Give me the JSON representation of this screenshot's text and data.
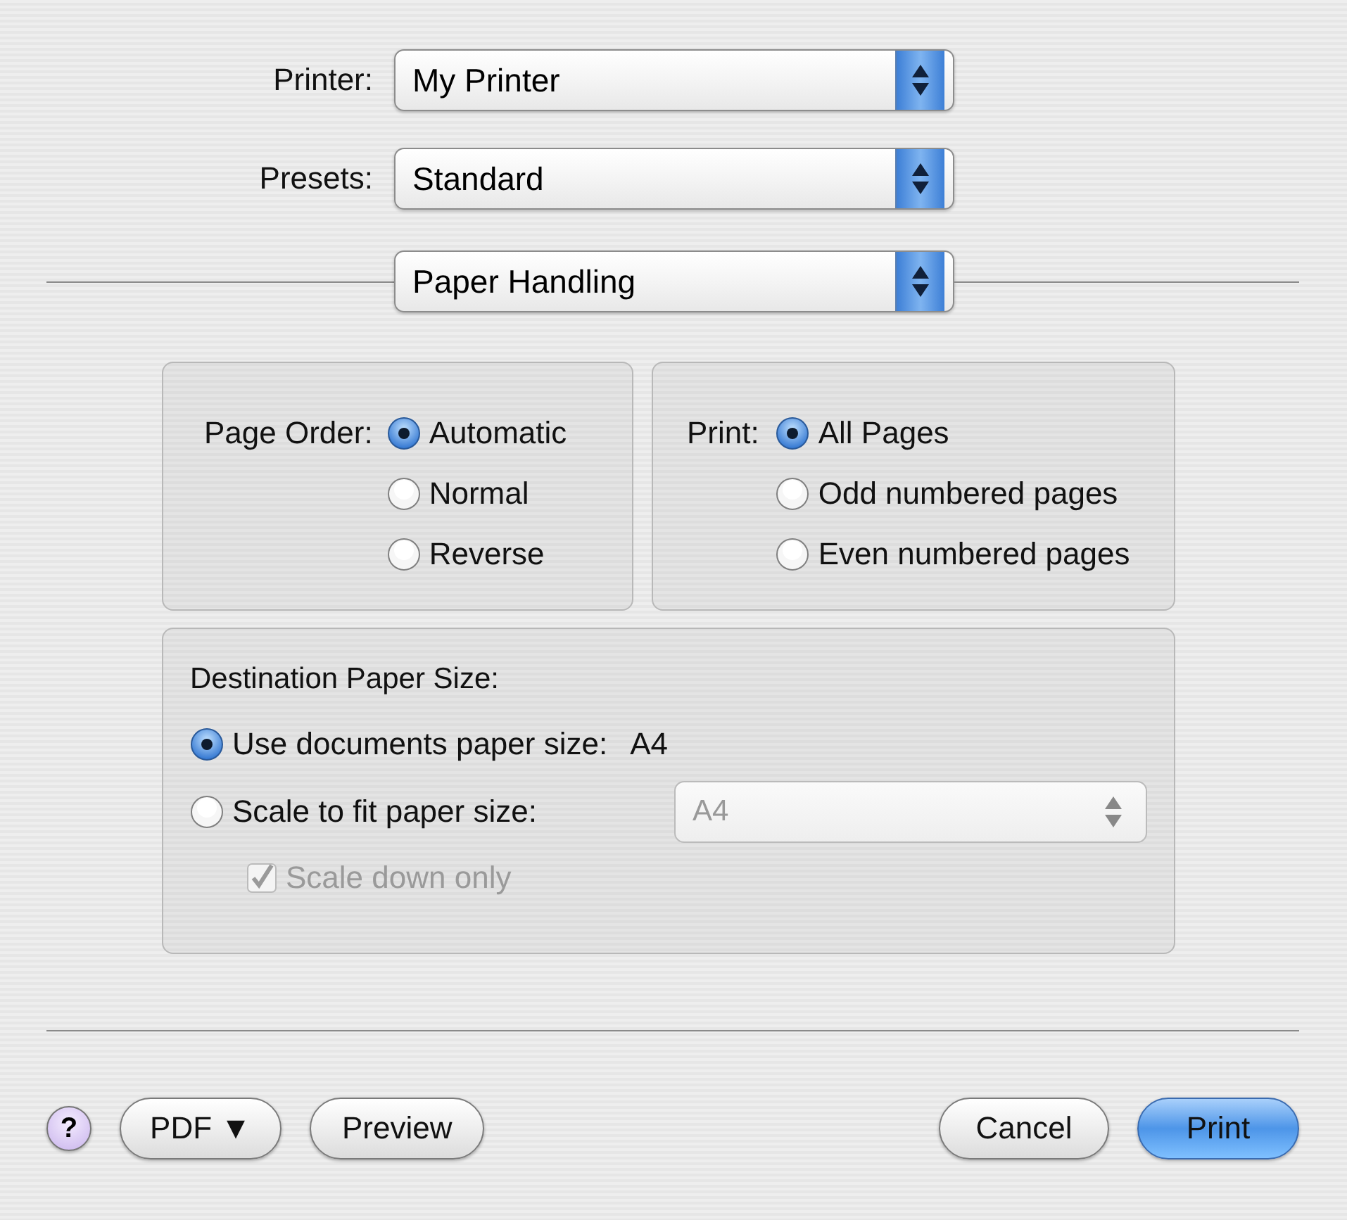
{
  "popups": [
    {
      "label": "Printer:",
      "value": "My Printer"
    },
    {
      "label": "Presets:",
      "value": "Standard"
    }
  ],
  "panel_menu": {
    "value": "Paper Handling"
  },
  "page_order": {
    "label": "Page Order:",
    "options": [
      {
        "label": "Automatic",
        "selected": true
      },
      {
        "label": "Normal",
        "selected": false
      },
      {
        "label": "Reverse",
        "selected": false
      }
    ]
  },
  "print_pages": {
    "label": "Print:",
    "options": [
      {
        "label": "All Pages",
        "selected": true
      },
      {
        "label": "Odd numbered pages",
        "selected": false
      },
      {
        "label": "Even numbered pages",
        "selected": false
      }
    ]
  },
  "destination": {
    "title": "Destination Paper Size:",
    "options": [
      {
        "label": "Use documents paper size:",
        "value": "A4",
        "selected": true
      },
      {
        "label": "Scale to fit paper size:",
        "selected": false
      }
    ],
    "scale_popup": {
      "value": "A4",
      "disabled": true
    },
    "scale_down": {
      "label": "Scale down only",
      "checked": true,
      "disabled": true
    }
  },
  "buttons": {
    "help": "?",
    "left": [
      {
        "label": "PDF ▼",
        "default": false
      },
      {
        "label": "Preview",
        "default": false
      }
    ],
    "right": [
      {
        "label": "Cancel",
        "default": false
      },
      {
        "label": "Print",
        "default": true
      }
    ]
  }
}
